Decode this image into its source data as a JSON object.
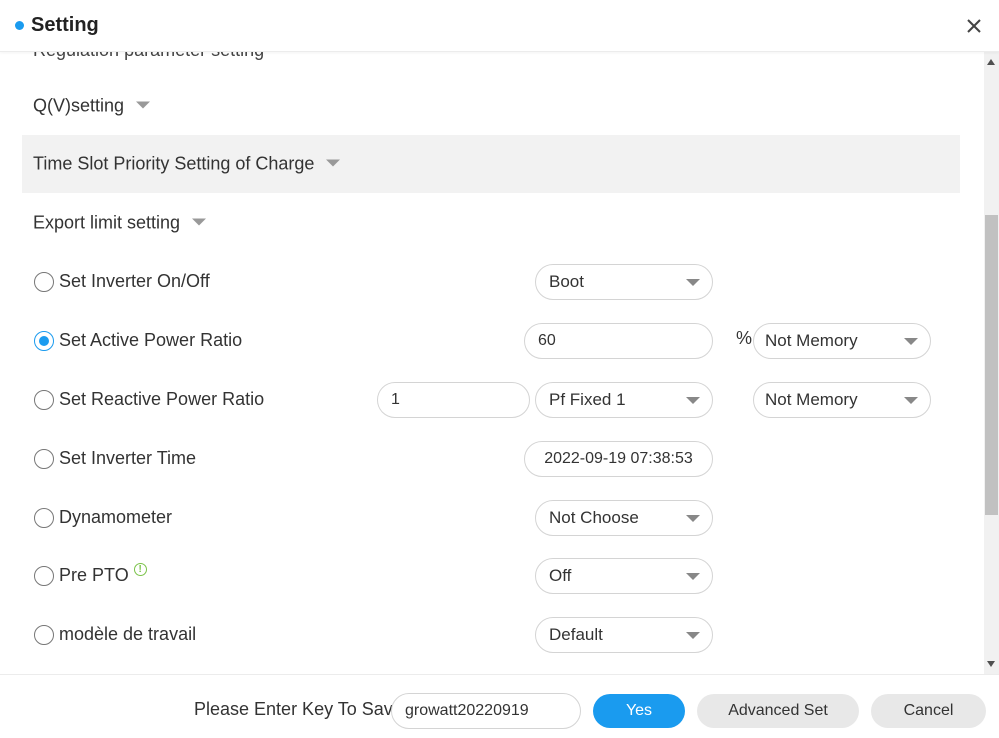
{
  "header": {
    "title": "Setting",
    "accent_color": "#1a9bef",
    "close_icon": "close-icon"
  },
  "sections": {
    "partial_label": "Regulation parameter setting",
    "qv": "Q(V)setting",
    "time_slot": "Time Slot Priority Setting of Charge",
    "export_limit": "Export limit setting"
  },
  "rows": {
    "inverter_onoff": {
      "label": "Set Inverter On/Off",
      "checked": false,
      "select_value": "Boot"
    },
    "active_power": {
      "label": "Set Active Power Ratio",
      "checked": true,
      "input_value": "60",
      "unit": "%",
      "memory_value": "Not Memory"
    },
    "reactive_power": {
      "label": "Set Reactive Power Ratio",
      "checked": false,
      "input_value": "1",
      "select_value": "Pf Fixed 1",
      "memory_value": "Not Memory"
    },
    "inverter_time": {
      "label": "Set Inverter Time",
      "checked": false,
      "date_value": "2022-09-19 07:38:53"
    },
    "dynamometer": {
      "label": "Dynamometer",
      "checked": false,
      "select_value": "Not Choose"
    },
    "pre_pto": {
      "label": "Pre PTO",
      "checked": false,
      "info_icon": "info-icon",
      "select_value": "Off"
    },
    "work_mode": {
      "label": "modèle de travail",
      "checked": false,
      "select_value": "Default"
    }
  },
  "footer": {
    "key_label": "Please Enter Key To Save",
    "key_value": "growatt20220919",
    "yes_label": "Yes",
    "advanced_label": "Advanced Set",
    "cancel_label": "Cancel"
  }
}
